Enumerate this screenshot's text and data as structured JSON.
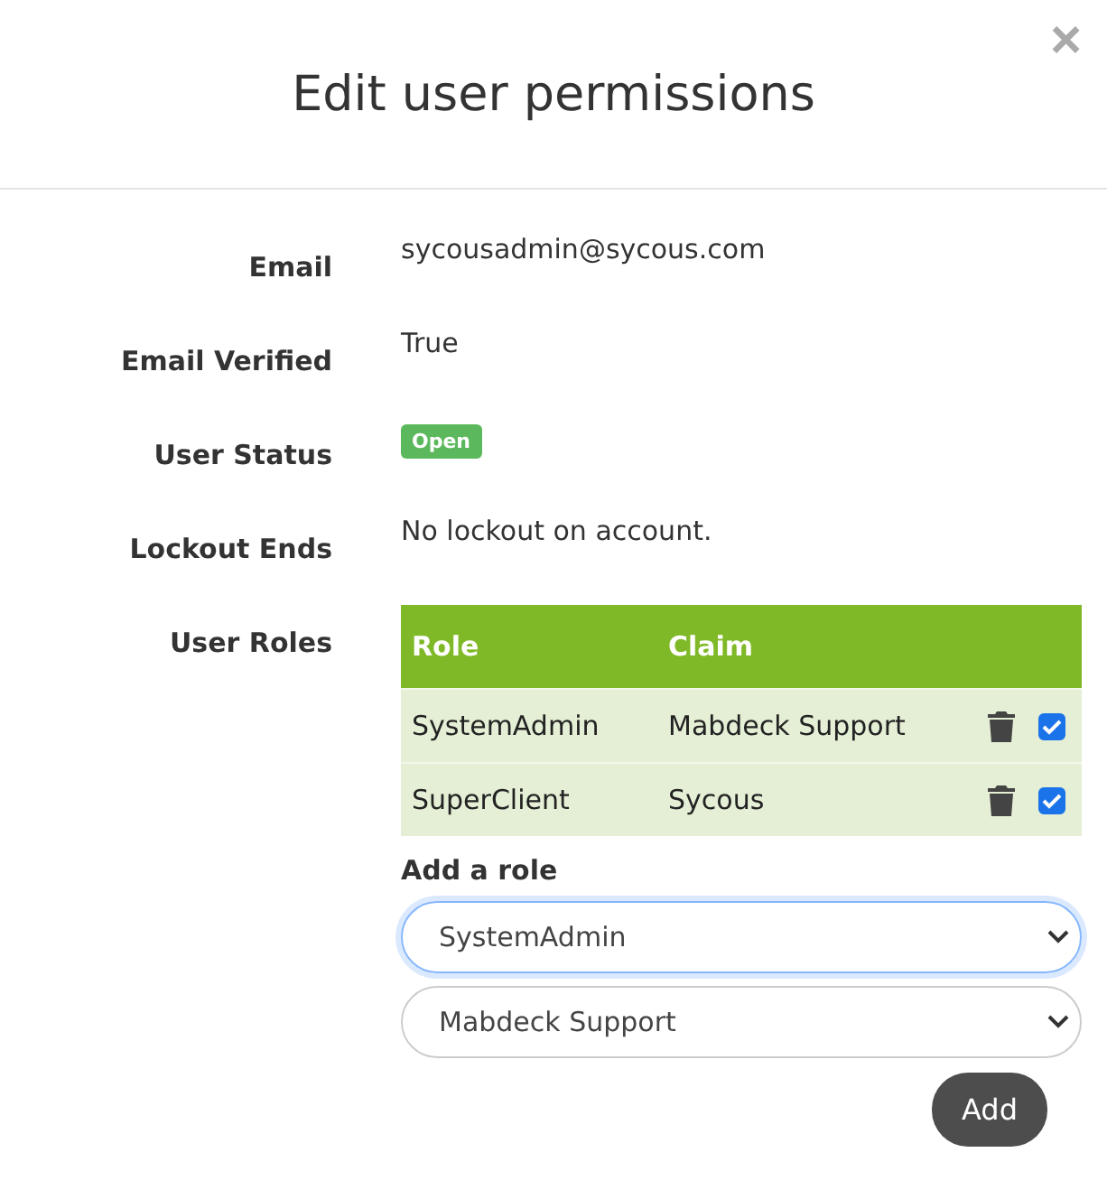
{
  "dialog": {
    "title": "Edit user permissions",
    "close": "×"
  },
  "fields": [
    {
      "label": "Email",
      "kind": "text",
      "value": "sycousadmin@sycous.com"
    },
    {
      "label": "Email Verified",
      "kind": "text",
      "value": "True"
    },
    {
      "label": "User Status",
      "kind": "badge",
      "value": "Open"
    },
    {
      "label": "Lockout Ends",
      "kind": "text",
      "value": "No lockout on account."
    }
  ],
  "roles": {
    "label": "User Roles",
    "columns": [
      "Role",
      "Claim"
    ],
    "rows": [
      {
        "role": "SystemAdmin",
        "claim": "Mabdeck Support",
        "checked": true
      },
      {
        "role": "SuperClient",
        "claim": "Sycous",
        "checked": true
      }
    ],
    "add_heading": "Add a role",
    "selects": [
      {
        "value": "SystemAdmin",
        "focused": true
      },
      {
        "value": "Mabdeck Support",
        "focused": false
      }
    ],
    "add_button": "Add"
  }
}
